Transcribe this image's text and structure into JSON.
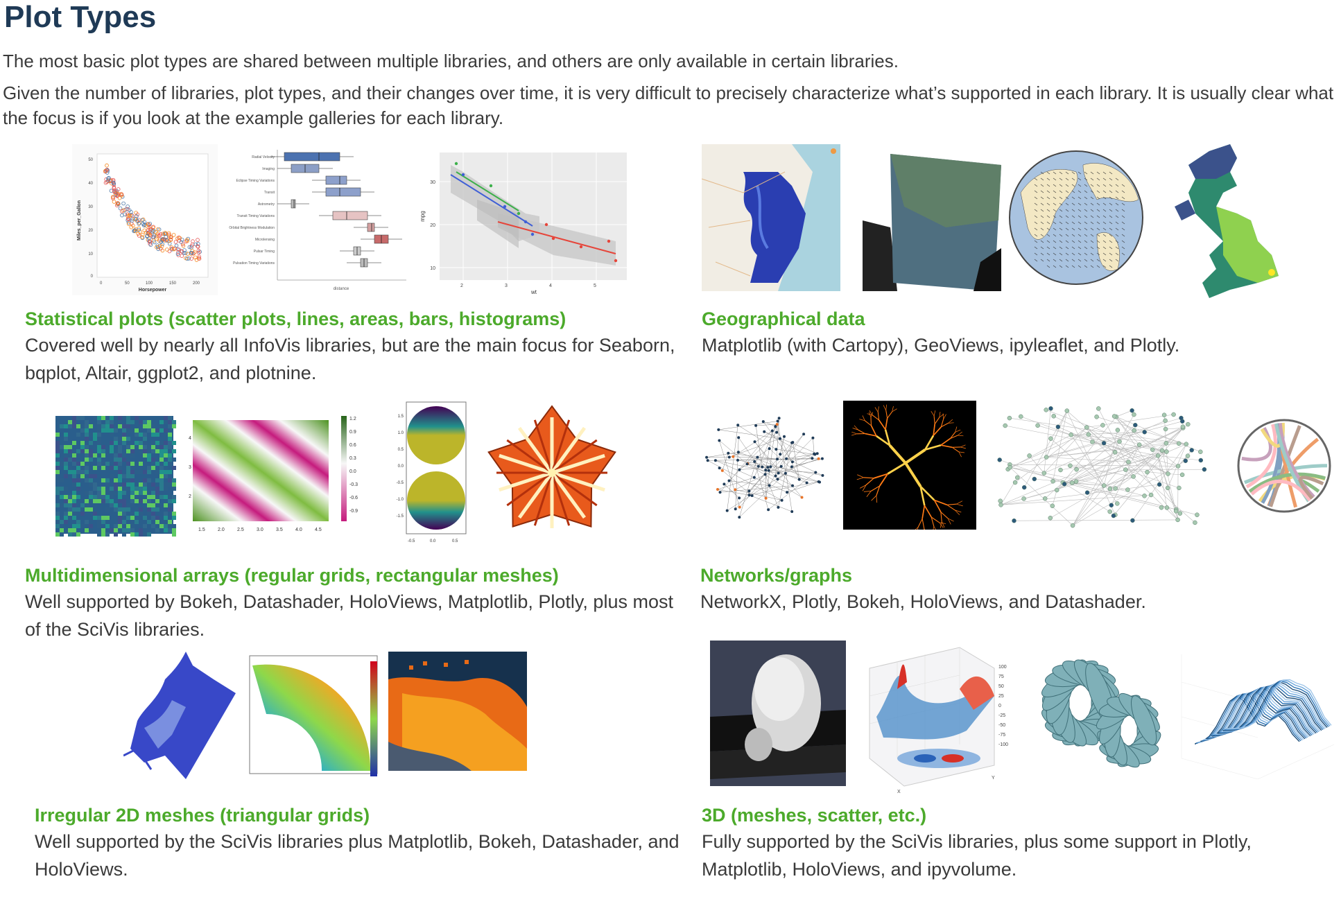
{
  "page": {
    "title": "Plot Types",
    "intro_1": "The most basic plot types are shared between multiple libraries, and others are only available in certain libraries.",
    "intro_2": "Given the number of libraries, plot types, and their changes over time, it is very difficult to precisely characterize what’s supported in each library. It is usually clear what the focus is if you look at the example galleries for each library."
  },
  "colors": {
    "heading": "#1f3a56",
    "accent_green": "#4caa2b",
    "text": "#3a3a3a"
  },
  "sections": [
    {
      "title": "Statistical plots (scatter plots, lines, areas, bars, histograms)",
      "description": "Covered well by nearly all InfoVis libraries, but are the main focus for Seaborn, bqplot, Altair, ggplot2, and plotnine.",
      "thumbnails": {
        "scatter": {
          "ylabel": "Miles_per_Gallon",
          "xlabel": "Horsepower",
          "yticks": [
            "50",
            "40",
            "30",
            "20",
            "10",
            "0"
          ],
          "xticks": [
            "0",
            "50",
            "100",
            "150",
            "200"
          ]
        },
        "boxplot": {
          "xlabel": "distance",
          "categories": [
            "Radial Velocity",
            "Imaging",
            "Eclipse Timing Variations",
            "Transit",
            "Astrometry",
            "Transit Timing Variations",
            "Orbital Brightness Modulation",
            "Microlensing",
            "Pulsar Timing",
            "Pulsation Timing Variations"
          ]
        },
        "regression": {
          "ylabel": "mpg",
          "xlabel": "wt",
          "yticks": [
            "30",
            "20",
            "10"
          ],
          "xticks": [
            "2",
            "3",
            "4",
            "5"
          ]
        }
      }
    },
    {
      "title": "Geographical data",
      "description": "Matplotlib (with Cartopy), GeoViews, ipyleaflet, and Plotly.",
      "thumbnails": {}
    },
    {
      "title": "Multidimensional arrays (regular grids, rectangular meshes)",
      "description": "Well supported by Bokeh, Datashader, HoloViews, Matplotlib, Plotly, plus most of the SciVis libraries.",
      "thumbnails": {
        "heatmap": {
          "yticks": [
            "4",
            "3",
            "2"
          ],
          "xticks": [
            "1.5",
            "2.0",
            "2.5",
            "3.0",
            "3.5",
            "4.0",
            "4.5"
          ],
          "colorbar": [
            "1.2",
            "0.9",
            "0.6",
            "0.3",
            "0.0",
            "-0.3",
            "-0.6",
            "-0.9"
          ]
        },
        "circles": {
          "yticks": [
            "1.5",
            "1.0",
            "0.5",
            "0.0",
            "-0.5",
            "-1.0",
            "-1.5"
          ],
          "xticks": [
            "-0.5",
            "0.0",
            "0.5"
          ]
        }
      }
    },
    {
      "title": "Networks/graphs",
      "description": "NetworkX, Plotly, Bokeh, HoloViews, and Datashader.",
      "thumbnails": {}
    },
    {
      "title": "Irregular 2D meshes (triangular grids)",
      "description": "Well supported by the SciVis libraries plus Matplotlib, Bokeh, Datashader, and HoloViews.",
      "thumbnails": {}
    },
    {
      "title": "3D (meshes, scatter, etc.)",
      "description": "Fully supported by the SciVis libraries, plus some support in Plotly, Matplotlib, HoloViews, and ipyvolume.",
      "thumbnails": {
        "surface": {
          "zticks": [
            "100",
            "75",
            "50",
            "25",
            "0",
            "-25",
            "-50",
            "-75",
            "-100"
          ],
          "xlabel": "X",
          "ylabel": "Y"
        }
      }
    }
  ]
}
